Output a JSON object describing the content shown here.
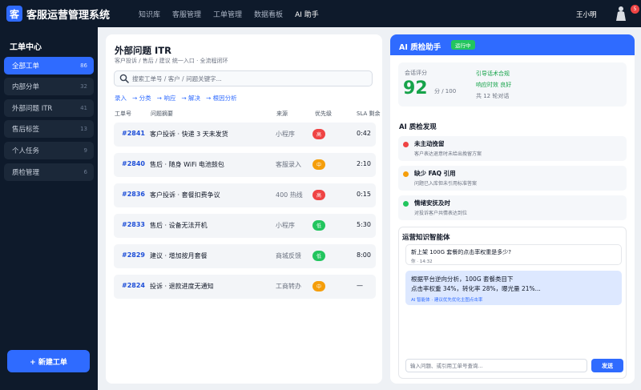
{
  "app": {
    "logo_char": "客",
    "title": "客服运营管理系统"
  },
  "topnav": [
    {
      "label": "知识库",
      "active": false
    },
    {
      "label": "客服管理",
      "active": false
    },
    {
      "label": "工单管理",
      "active": false
    },
    {
      "label": "数据看板",
      "active": false
    },
    {
      "label": "AI 助手",
      "active": true
    }
  ],
  "user": {
    "name": "王小明",
    "notifications": "5"
  },
  "sidebar": {
    "title": "工单中心",
    "items": [
      {
        "label": "全部工单",
        "count": "86",
        "active": true
      },
      {
        "label": "内部分单",
        "count": "32",
        "active": false
      },
      {
        "label": "外部问题 ITR",
        "count": "41",
        "active": false
      },
      {
        "label": "售后标签",
        "count": "13",
        "active": false
      },
      {
        "label": "个人任务",
        "count": "9",
        "active": false
      },
      {
        "label": "质检管理",
        "count": "6",
        "active": false
      }
    ],
    "new_button": "+  新建工单"
  },
  "tickets": {
    "title": "外部问题 ITR",
    "subtitle": "客户投诉 / 售后 / 建议 统一入口 · 全流程闭环",
    "search_placeholder": "搜索工单号 / 客户 / 问题关键字...",
    "flow": [
      "录入",
      "→ 分类",
      "→ 响应",
      "→ 解决",
      "→ 根因分析"
    ],
    "columns": [
      "工单号",
      "问题摘要",
      "来源",
      "优先级",
      "SLA 剩余"
    ],
    "rows": [
      {
        "id": "#2841",
        "summary": "客户投诉 · 快递 3 天未发货",
        "source": "小程序",
        "priority": "高",
        "sla": "0:42"
      },
      {
        "id": "#2840",
        "summary": "售后 · 随身 WiFi 电池鼓包",
        "source": "客服录入",
        "priority": "中",
        "sla": "2:10"
      },
      {
        "id": "#2836",
        "summary": "客户投诉 · 套餐扣费争议",
        "source": "400 热线",
        "priority": "高",
        "sla": "0:15"
      },
      {
        "id": "#2833",
        "summary": "售后 · 设备无法开机",
        "source": "小程序",
        "priority": "低",
        "sla": "5:30"
      },
      {
        "id": "#2829",
        "summary": "建议 · 增加按月套餐",
        "source": "商城反馈",
        "priority": "低",
        "sla": "8:00"
      },
      {
        "id": "#2824",
        "summary": "投诉 · 退款进度无通知",
        "source": "工商转办",
        "priority": "中",
        "sla": "—"
      }
    ]
  },
  "priority_colors": {
    "高": "#ef4444",
    "中": "#f59e0b",
    "低": "#22c55e"
  },
  "qa": {
    "title": "AI 质检助手",
    "status": "运行中",
    "score_label": "会话评分",
    "score": "92",
    "score_unit": "分 / 100",
    "notes": [
      "引导话术合规",
      "响应时效 良好",
      "共 12 轮对话"
    ],
    "findings_title": "AI 质检发现",
    "findings": [
      {
        "title": "未主动挽留",
        "desc": "客户表达退意时未给出挽留方案",
        "color": "#ef4444"
      },
      {
        "title": "缺少 FAQ 引用",
        "desc": "问题已入库但未引用标准答案",
        "color": "#f59e0b"
      },
      {
        "title": "情绪安抚及时",
        "desc": "对投诉客户共情表达到位",
        "color": "#22c55e"
      }
    ]
  },
  "agent": {
    "title": "运营知识智能体",
    "question": "新上架 100G 套餐的点击率权重是多少?",
    "question_time": "你 · 14:32",
    "answer_lines": [
      "根据平台逆向分析，100G 套餐类目下",
      "点击率权重 34%，转化率 28%，曝光量 21%..."
    ],
    "answer_tag": "AI 智能体 · 建议优先优化主图点击率",
    "input_placeholder": "输入问题、或引用工单号查询...",
    "send_label": "发送"
  }
}
